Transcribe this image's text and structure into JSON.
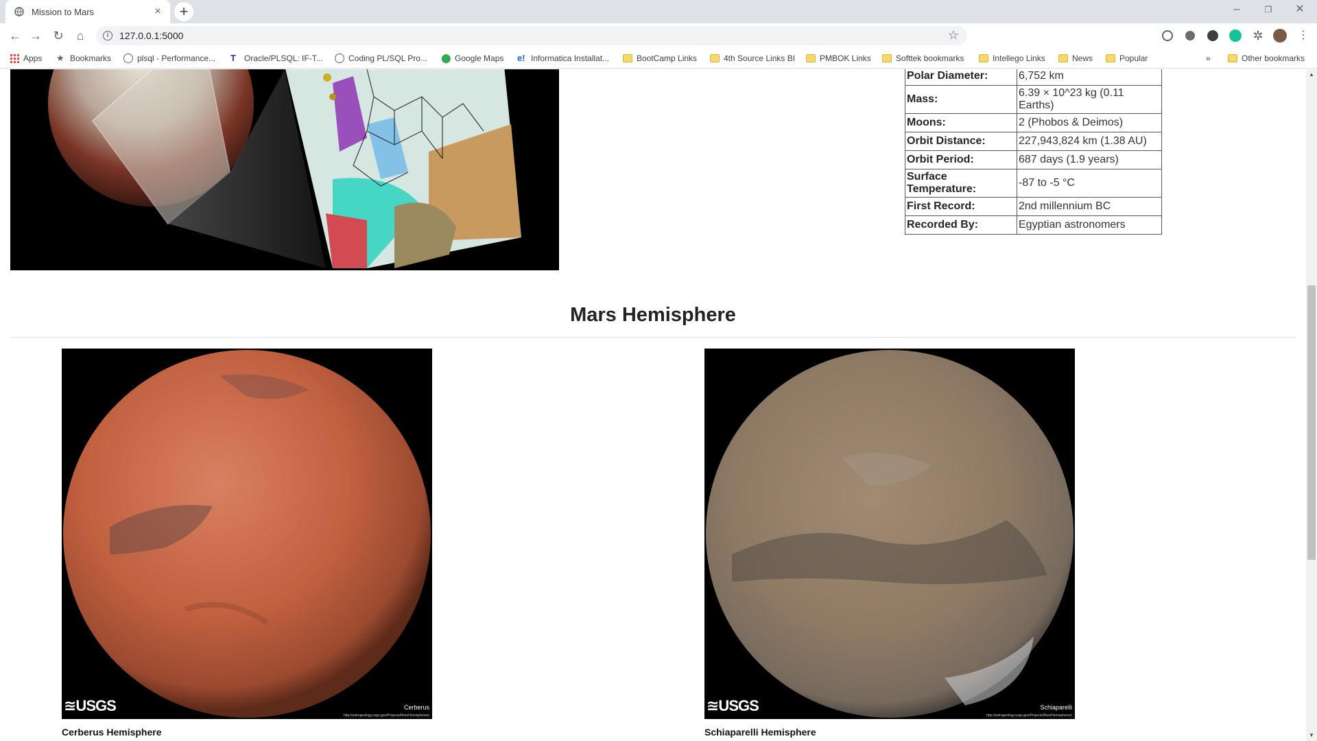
{
  "browser": {
    "tab_title": "Mission to Mars",
    "url": "127.0.0.1:5000",
    "bookmarks": [
      {
        "label": "Apps"
      },
      {
        "label": "Bookmarks"
      },
      {
        "label": "plsql - Performance..."
      },
      {
        "label": "Oracle/PLSQL: IF-T..."
      },
      {
        "label": "Coding PL/SQL Pro..."
      },
      {
        "label": "Google Maps"
      },
      {
        "label": "Informatica Installat..."
      },
      {
        "label": "BootCamp Links"
      },
      {
        "label": "4th Source Links BI"
      },
      {
        "label": "PMBOK Links"
      },
      {
        "label": "Softtek bookmarks"
      },
      {
        "label": "Intellego Links"
      },
      {
        "label": "News"
      },
      {
        "label": "Popular"
      }
    ],
    "overflow_label": "»",
    "other_bookmarks": "Other bookmarks"
  },
  "facts": [
    {
      "key": "Polar Diameter:",
      "value": "6,752 km"
    },
    {
      "key": "Mass:",
      "value": "6.39 × 10^23 kg (0.11 Earths)"
    },
    {
      "key": "Moons:",
      "value": "2 (Phobos & Deimos)"
    },
    {
      "key": "Orbit Distance:",
      "value": "227,943,824 km (1.38 AU)"
    },
    {
      "key": "Orbit Period:",
      "value": "687 days (1.9 years)"
    },
    {
      "key": "Surface Temperature:",
      "value": "-87 to -5 °C"
    },
    {
      "key": "First Record:",
      "value": "2nd millennium BC"
    },
    {
      "key": "Recorded By:",
      "value": "Egyptian astronomers"
    }
  ],
  "hemispheres": {
    "title": "Mars Hemisphere",
    "items": [
      {
        "caption": "Cerberus Hemisphere",
        "image_label": "Cerberus",
        "logo": "≊USGS",
        "url_text": "http://astrogeology.usgs.gov/Projects/MarsHemispheres/"
      },
      {
        "caption": "Schiaparelli Hemisphere",
        "image_label": "Schiaparelli",
        "logo": "≊USGS",
        "url_text": "http://astrogeology.usgs.gov/Projects/MarsHemispheres/"
      }
    ]
  },
  "colors": {
    "tabstrip": "#dee1e6",
    "mars_red": "#c0603f",
    "mars_tan": "#8f7a64"
  }
}
